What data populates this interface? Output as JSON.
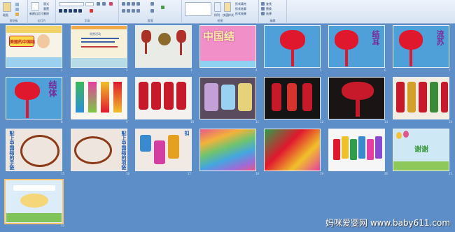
{
  "ribbon": {
    "groups": [
      {
        "label": "剪贴板"
      },
      {
        "label": "幻灯片"
      },
      {
        "label": "字体"
      },
      {
        "label": "段落"
      },
      {
        "label": "绘图"
      },
      {
        "label": "编辑"
      }
    ],
    "buttons": {
      "paste": "粘贴",
      "new_slide": "新建幻灯片",
      "layout": "版式",
      "reset": "重置",
      "delete": "删除",
      "shape_fill": "形状填充",
      "shape_outline": "形状轮廓",
      "shape_effect": "形状效果",
      "quick_styles": "快速样式",
      "arrange": "排列",
      "find": "查找",
      "replace": "替换",
      "select": "选择"
    }
  },
  "slides": [
    {
      "num": "1",
      "title": "美丽的中国结"
    },
    {
      "num": "2",
      "text": "欣赏活动"
    },
    {
      "num": "3"
    },
    {
      "num": "4",
      "title": "中国结"
    },
    {
      "num": "5"
    },
    {
      "num": "6",
      "title": "结耳"
    },
    {
      "num": "7",
      "title": "流苏"
    },
    {
      "num": "8",
      "title": "结体"
    },
    {
      "num": "9"
    },
    {
      "num": "10"
    },
    {
      "num": "11"
    },
    {
      "num": "12"
    },
    {
      "num": "13"
    },
    {
      "num": "14"
    },
    {
      "num": "15",
      "title": "配上中国结的手链"
    },
    {
      "num": "16",
      "title": "配上中国结的项链"
    },
    {
      "num": "17",
      "title": "配上中国结的钥匙扣"
    },
    {
      "num": "18"
    },
    {
      "num": "19"
    },
    {
      "num": "20"
    },
    {
      "num": "21",
      "title": "谢谢"
    },
    {
      "num": "22"
    }
  ],
  "watermark": "妈咪爱婴网 www.baby611.com",
  "colors": {
    "sorter_bg": "#5d8ec8",
    "ribbon_bg": "#dbe6f4",
    "knot_red": "#d4122b",
    "selection": "#f6c36b"
  }
}
